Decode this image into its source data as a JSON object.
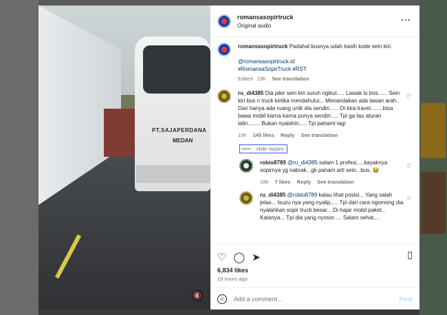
{
  "post": {
    "username": "romansasopirtruck",
    "audio": "Original audio",
    "caption_user": "romansasopirtruck",
    "caption_text": "Padahal busnya udah kasih kode sein kiri.",
    "mention": "@romansasopirtruck.id",
    "hashtags": "#RomansaSopirTruck #RST",
    "edited_meta": "Edited · 19h",
    "see_translation": "See translation",
    "bus_text_line1": "PT.SAJAPERDANA",
    "bus_text_line2": "MEDAN"
  },
  "comments": [
    {
      "username": "ru_di4385",
      "text": "Dia pikir sein kiri suruh ngikut..... Lawak lu bos...... Sein kiri bus n truck ketika mendahului... Menandakan ada lawan arah.. Dan hanya ada ruang untk dia sendiri...... Di kira travel........bisa bawa mobil karna karna punya sendiri..... Tpi ga tau aturan lalin........ Bukan nyalahin..... Tpi pahami lagi",
      "time": "19h",
      "likes": "145 likes",
      "reply": "Reply",
      "translate": "See translation"
    }
  ],
  "hide_replies": "Hide replies",
  "replies": [
    {
      "username": "robio8789",
      "mention": "@ru_di4385",
      "text": "salam 1 profesi.....kayaknya sopirnya yg nabrak...gk paham arti sein...bus. 😂",
      "time": "18h",
      "likes": "7 likes",
      "reply": "Reply",
      "translate": "See translation"
    },
    {
      "username": "ru_di4385",
      "mention": "@robio8789",
      "text": "kalau lihat posisi... Yang salah jelas... Isuzu nya yang nyalip..... Tpi dari cara ngomong dia nyalahkan sopir truck besar... Di hajar mobil paket.. Katanya... Tpi dia yang nyosor..... Salam sehat....",
      "time": "",
      "likes": "",
      "reply": "",
      "translate": ""
    }
  ],
  "footer": {
    "likes": "6,834 likes",
    "date": "19 hours ago",
    "comment_placeholder": "Add a comment...",
    "post_label": "Post"
  },
  "icons": {
    "heart": "heart-icon",
    "comment": "comment-icon",
    "share": "share-icon",
    "bookmark": "bookmark-icon",
    "emoji": "emoji-icon",
    "mute": "mute-icon",
    "more": "more-icon"
  },
  "colors": {
    "link": "#00376b",
    "post_button": "#b2dffc",
    "secondary_text": "#737373"
  }
}
